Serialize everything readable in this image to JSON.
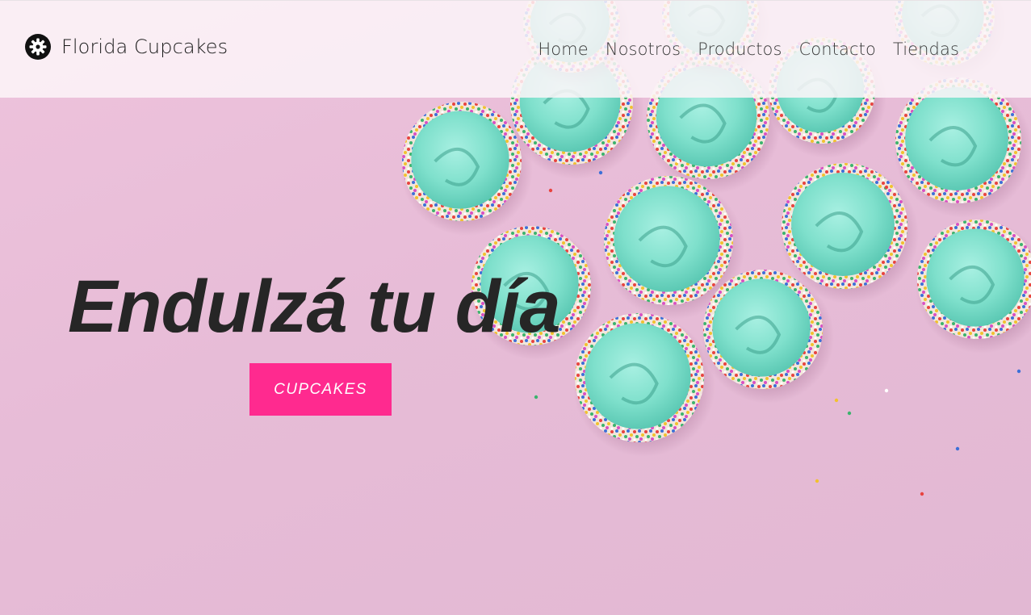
{
  "header": {
    "brand": "Florida Cupcakes",
    "brand_icon": "cupcake-gear-icon",
    "nav": [
      "Home",
      "Nosotros",
      "Productos",
      "Contacto",
      "Tiendas"
    ]
  },
  "hero": {
    "headline": "Endulzá tu día",
    "cta_label": "CUPCAKES",
    "background_image": "cupcakes-with-mint-frosting-and-sprinkles"
  },
  "colors": {
    "cta": "#ff2a8f",
    "background": "#e7bcd7",
    "frosting": "#7fe3cf",
    "headline": "#262626"
  }
}
